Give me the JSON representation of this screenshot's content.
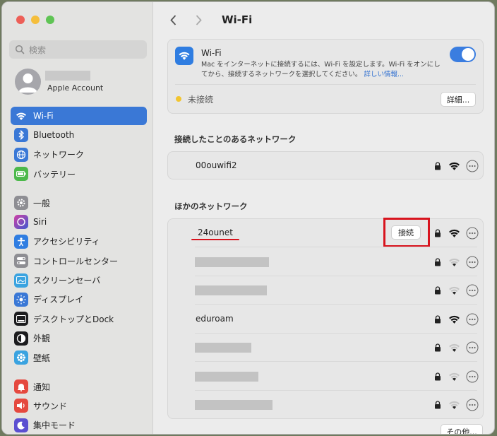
{
  "sidebar": {
    "search_placeholder": "検索",
    "account_label": "Apple Account",
    "items": [
      {
        "label": "Wi-Fi",
        "icon": "wifi-icon",
        "color": "#3a78d6",
        "active": true
      },
      {
        "label": "Bluetooth",
        "icon": "bluetooth-icon",
        "color": "#3a78d6"
      },
      {
        "label": "ネットワーク",
        "icon": "globe-icon",
        "color": "#3a78d6"
      },
      {
        "label": "バッテリー",
        "icon": "battery-icon",
        "color": "#4cb94a"
      },
      {
        "label": "一般",
        "icon": "gear-icon",
        "color": "#8e8e93"
      },
      {
        "label": "Siri",
        "icon": "siri-icon",
        "color": "#6b3fd1"
      },
      {
        "label": "アクセシビリティ",
        "icon": "accessibility-icon",
        "color": "#2f7de1"
      },
      {
        "label": "コントロールセンター",
        "icon": "control-center-icon",
        "color": "#8e8e93"
      },
      {
        "label": "スクリーンセーバ",
        "icon": "screensaver-icon",
        "color": "#3aa3e0"
      },
      {
        "label": "ディスプレイ",
        "icon": "display-icon",
        "color": "#3a78d6"
      },
      {
        "label": "デスクトップとDock",
        "icon": "dock-icon",
        "color": "#1c1c1e"
      },
      {
        "label": "外観",
        "icon": "appearance-icon",
        "color": "#1c1c1e"
      },
      {
        "label": "壁紙",
        "icon": "wallpaper-icon",
        "color": "#3aa3e0"
      },
      {
        "label": "通知",
        "icon": "bell-icon",
        "color": "#e5493f"
      },
      {
        "label": "サウンド",
        "icon": "speaker-icon",
        "color": "#e5493f"
      },
      {
        "label": "集中モード",
        "icon": "moon-icon",
        "color": "#5b4fd1"
      }
    ]
  },
  "header": {
    "title": "Wi-Fi"
  },
  "wifi": {
    "title": "Wi-Fi",
    "description": "Mac をインターネットに接続するには、Wi-Fi を設定します。Wi-Fi をオンにしてから、接続するネットワークを選択してください。",
    "learn_more": "詳しい情報...",
    "enabled": true,
    "status": "未接続",
    "details_button": "詳細..."
  },
  "known_networks": {
    "title": "接続したことのあるネットワーク",
    "items": [
      {
        "name": "00ouwifi2",
        "strength": "full"
      }
    ]
  },
  "other_networks": {
    "title": "ほかのネットワーク",
    "connect_button": "接続",
    "items": [
      {
        "name": "24ounet",
        "strength": "full",
        "highlighted": true
      },
      {
        "name": "",
        "strength": "weak"
      },
      {
        "name": "",
        "strength": "weak"
      },
      {
        "name": "eduroam",
        "strength": "full"
      },
      {
        "name": "",
        "strength": "weak"
      },
      {
        "name": "",
        "strength": "weak"
      },
      {
        "name": "",
        "strength": "weak"
      }
    ],
    "other_button": "その他..."
  }
}
